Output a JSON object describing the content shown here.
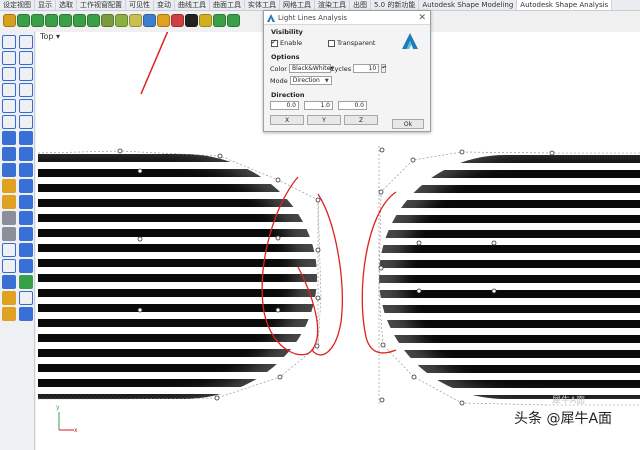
{
  "tabs": [
    "设定视图",
    "显示",
    "选取",
    "工作视窗配置",
    "可见性",
    "变动",
    "曲线工具",
    "曲面工具",
    "实体工具",
    "网格工具",
    "渲染工具",
    "出图",
    "5.0 的新功能",
    "Autodesk Shape Modeling",
    "Autodesk Shape Analysis"
  ],
  "active_tab_index": 14,
  "viewport": {
    "label": "Top",
    "dropdown_icon": "chevron-down-icon"
  },
  "dialog": {
    "title": "Light Lines Analysis",
    "close": "✕",
    "visibility_heading": "Visibility",
    "enable_label": "Enable",
    "enable_checked": true,
    "transparent_label": "Transparent",
    "transparent_checked": false,
    "options_heading": "Options",
    "color_label": "Color",
    "color_value": "Black&White",
    "cycles_label": "Cycles",
    "cycles_value": "10",
    "mode_label": "Mode",
    "mode_value": "Direction",
    "direction_heading": "Direction",
    "dir_x": "0.0",
    "dir_y": "1.0",
    "dir_z": "0.0",
    "x_button": "X",
    "y_button": "Y",
    "z_button": "Z",
    "ok_button": "Ok",
    "brand_color": "#1a7fb8"
  },
  "axis": {
    "y": "y",
    "x": "x"
  },
  "watermark": {
    "text": "头条 @犀牛A面",
    "faint": "犀牛A面"
  },
  "colors": {
    "annotation": "#e02020",
    "background": "#ffffff"
  }
}
